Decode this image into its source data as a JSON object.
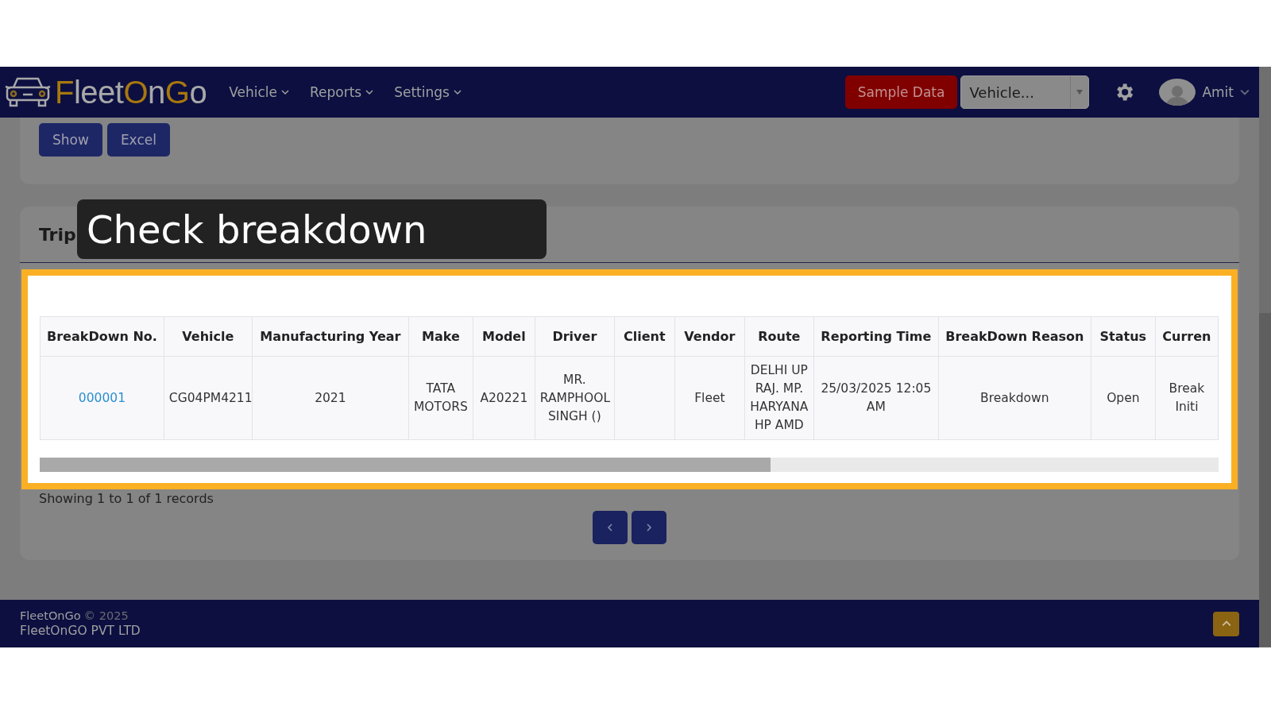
{
  "nav": {
    "logo": [
      {
        "text": "F",
        "accent": true
      },
      {
        "text": "leet",
        "accent": false
      },
      {
        "text": "O",
        "accent": true
      },
      {
        "text": "n",
        "accent": false
      },
      {
        "text": "G",
        "accent": true
      },
      {
        "text": "o",
        "accent": false
      }
    ],
    "menu": [
      {
        "label": "Vehicle"
      },
      {
        "label": "Reports"
      },
      {
        "label": "Settings"
      }
    ],
    "sample_button": "Sample Data",
    "vehicle_select": {
      "value": "Vehicle..."
    },
    "user": {
      "name": "Amit"
    }
  },
  "filter_buttons": [
    "Show",
    "Excel"
  ],
  "section": {
    "title": "Trip"
  },
  "callout": "Check breakdown",
  "table": {
    "columns": [
      "BreakDown No.",
      "Vehicle",
      "Manufacturing Year",
      "Make",
      "Model",
      "Driver",
      "Client",
      "Vendor",
      "Route",
      "Reporting Time",
      "BreakDown Reason",
      "Status",
      "Curren"
    ],
    "rows": [
      {
        "cells": [
          "000001",
          "CG04PM4211",
          "2021",
          "TATA MOTORS",
          "A20221",
          "MR. RAMPHOOL SINGH ()",
          null,
          "Fleet",
          "DELHI UP RAJ. MP. HARYANA HP AMD",
          "25/03/2025 12:05 AM",
          "Breakdown",
          "Open",
          "Break Initi"
        ]
      }
    ]
  },
  "records_info": "Showing 1 to 1 of 1 records",
  "footer": {
    "brand": "FleetOnGo",
    "copyright": "© 2025",
    "company": "FleetOnGO PVT LTD"
  }
}
